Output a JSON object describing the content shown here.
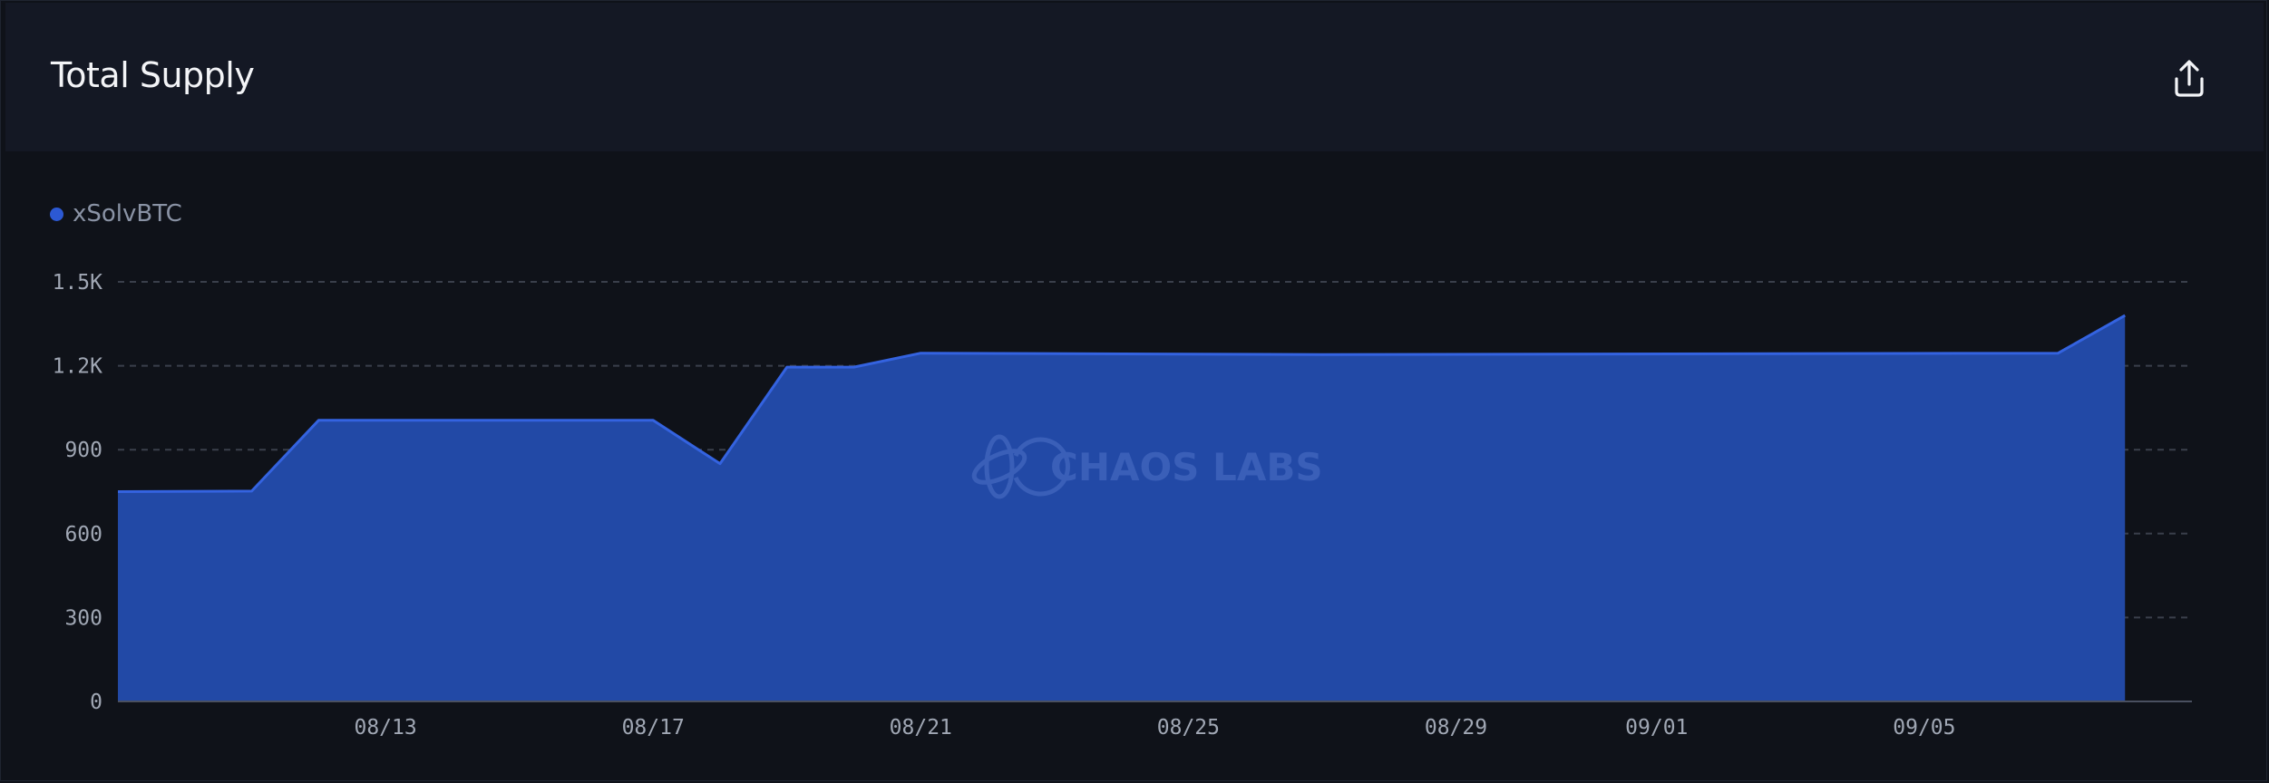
{
  "header": {
    "title": "Total Supply",
    "export_icon": "upload-icon"
  },
  "watermark": {
    "text": "CHAOS LABS",
    "icon": "chaos-labs-logo-icon"
  },
  "colors": {
    "series": "#2c59d4",
    "area_fill": "#2249a6",
    "line": "#3463e0",
    "grid": "#3a3f4b",
    "background": "#0f1219",
    "header_background": "#141824"
  },
  "chart_data": {
    "type": "area",
    "title": "Total Supply",
    "xlabel": "",
    "ylabel": "",
    "ylim": [
      0,
      1500
    ],
    "yticks": [
      0,
      300,
      600,
      900,
      1200,
      1500
    ],
    "ytick_labels": [
      "0",
      "300",
      "600",
      "900",
      "1.2K",
      "1.5K"
    ],
    "x_start": "08/09",
    "x_end": "09/09",
    "xtick_labels": [
      "08/13",
      "08/17",
      "08/21",
      "08/25",
      "08/29",
      "09/01",
      "09/05"
    ],
    "grid": true,
    "legend": "top-left",
    "series": [
      {
        "name": "xSolvBTC",
        "x": [
          "08/09",
          "08/11",
          "08/12",
          "08/17",
          "08/18",
          "08/19",
          "08/20",
          "08/21",
          "08/27",
          "09/07",
          "09/08"
        ],
        "values": [
          750,
          752,
          1005,
          1005,
          850,
          1195,
          1195,
          1245,
          1240,
          1245,
          1380
        ]
      }
    ]
  }
}
